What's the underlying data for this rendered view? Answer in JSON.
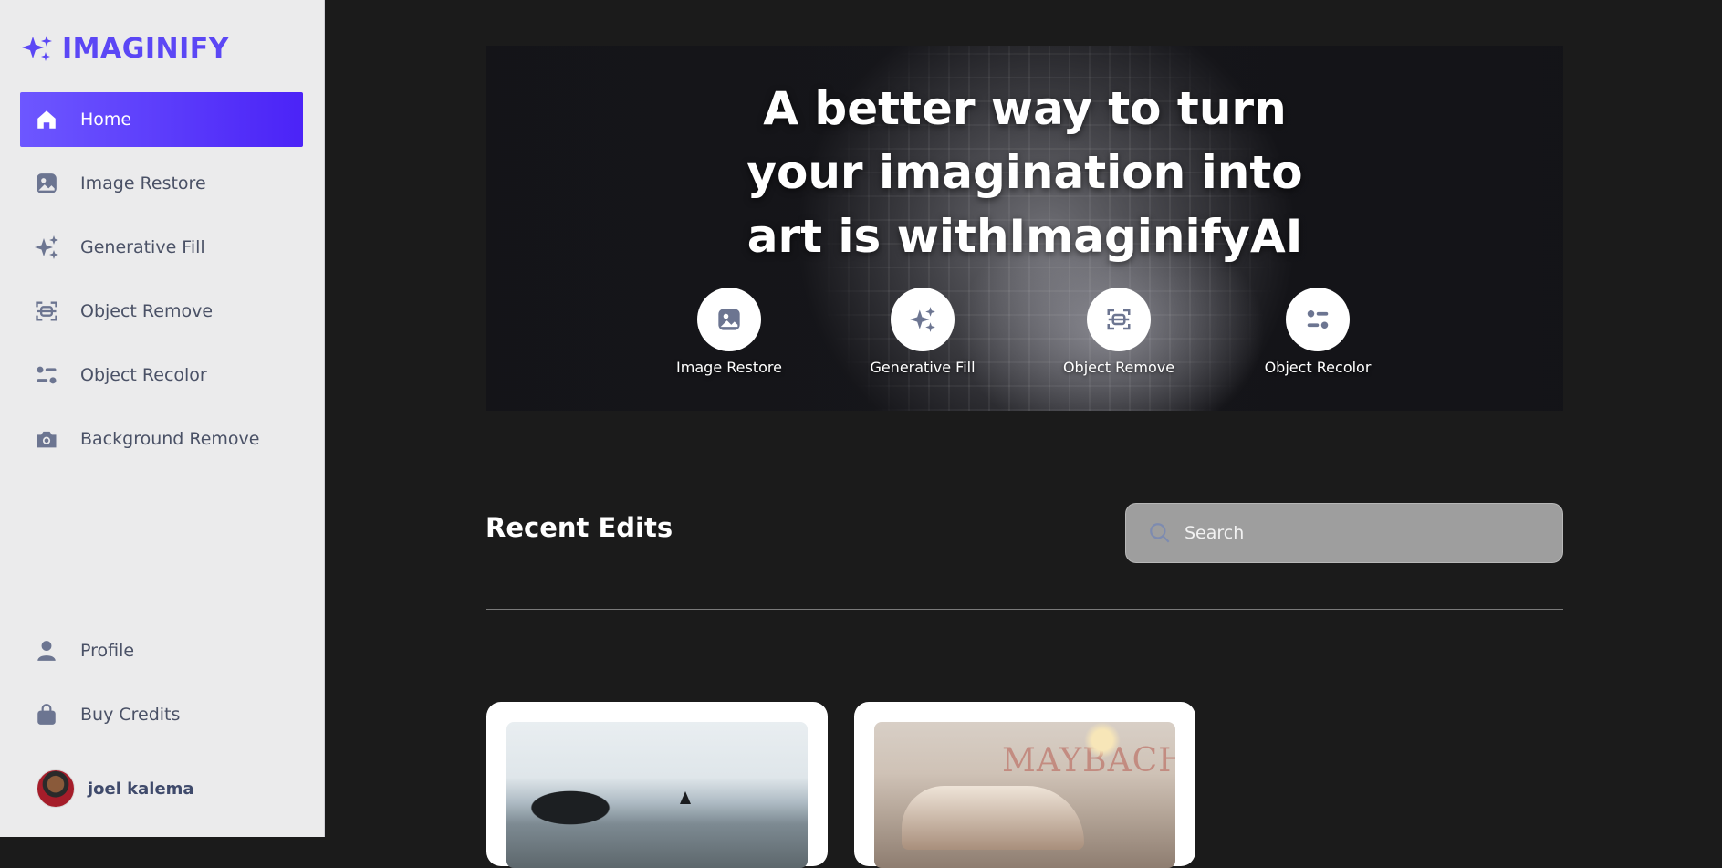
{
  "brand": {
    "name": "IMAGINIFY",
    "accent": "#5b47f5"
  },
  "sidebar": {
    "items": [
      {
        "label": "Home",
        "icon": "home-icon",
        "active": true
      },
      {
        "label": "Image Restore",
        "icon": "image-icon"
      },
      {
        "label": "Generative Fill",
        "icon": "stars-icon"
      },
      {
        "label": "Object Remove",
        "icon": "scan-icon"
      },
      {
        "label": "Object Recolor",
        "icon": "filter-icon"
      },
      {
        "label": "Background Remove",
        "icon": "camera-icon"
      }
    ],
    "bottom_items": [
      {
        "label": "Profile",
        "icon": "user-icon"
      },
      {
        "label": "Buy Credits",
        "icon": "bag-icon"
      }
    ],
    "user": {
      "name": "joel kalema"
    }
  },
  "hero": {
    "title": "A better way to turn your imagination into art is withImaginifyAI",
    "tools": [
      {
        "label": "Image Restore",
        "icon": "image-icon"
      },
      {
        "label": "Generative Fill",
        "icon": "stars-icon"
      },
      {
        "label": "Object Remove",
        "icon": "scan-icon"
      },
      {
        "label": "Object Recolor",
        "icon": "filter-icon"
      }
    ]
  },
  "recent": {
    "title": "Recent Edits",
    "search_placeholder": "Search",
    "cards": [
      {
        "image": "rocky-beach"
      },
      {
        "image": "car-showroom",
        "sign": "MAYBACH"
      }
    ]
  }
}
